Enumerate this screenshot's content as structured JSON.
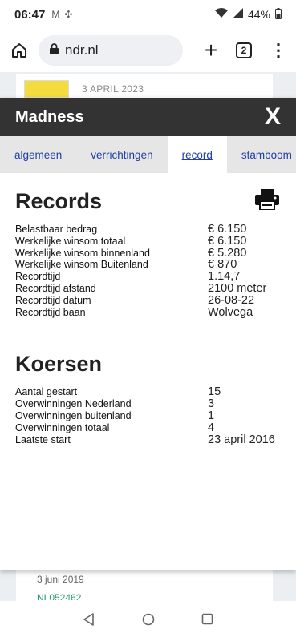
{
  "status_bar": {
    "time": "06:47",
    "battery": "44%"
  },
  "browser": {
    "url": "ndr.nl",
    "tab_count": "2"
  },
  "background": {
    "date_top": "3 APRIL 2023",
    "date_bottom": "3 juni 2019",
    "link_text": "NL052462"
  },
  "modal": {
    "title": "Madness",
    "close_label": "X"
  },
  "tabs": [
    {
      "label": "algemeen"
    },
    {
      "label": "verrichtingen"
    },
    {
      "label": "record"
    },
    {
      "label": "stamboom"
    }
  ],
  "records": {
    "title": "Records",
    "rows": [
      {
        "label": "Belastbaar bedrag",
        "value": "€ 6.150"
      },
      {
        "label": "Werkelijke winsom totaal",
        "value": "€ 6.150"
      },
      {
        "label": "Werkelijke winsom binnenland",
        "value": "€ 5.280"
      },
      {
        "label": "Werkelijke winsom Buitenland",
        "value": "€ 870"
      },
      {
        "label": "Recordtijd",
        "value": "1.14,7"
      },
      {
        "label": "Recordtijd afstand",
        "value": "2100 meter"
      },
      {
        "label": "Recordtijd datum",
        "value": "26-08-22"
      },
      {
        "label": "Recordtijd baan",
        "value": "Wolvega"
      }
    ]
  },
  "koersen": {
    "title": "Koersen",
    "rows": [
      {
        "label": "Aantal gestart",
        "value": "15"
      },
      {
        "label": "Overwinningen Nederland",
        "value": "3"
      },
      {
        "label": "Overwinningen buitenland",
        "value": "1"
      },
      {
        "label": "Overwinningen totaal",
        "value": "4"
      },
      {
        "label": "Laatste start",
        "value": "23 april 2016"
      }
    ]
  }
}
